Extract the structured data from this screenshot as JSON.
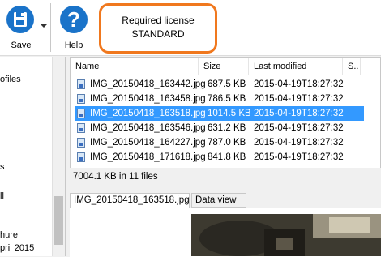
{
  "toolbar": {
    "save_label": "Save",
    "help_label": "Help",
    "save_icon": "floppy-disk-icon",
    "help_icon": "question-mark-icon"
  },
  "license": {
    "line1": "Required license",
    "line2": "STANDARD",
    "border_color": "#f0781e"
  },
  "tree": {
    "items": [
      "ofiles",
      "s",
      "ll",
      "hure",
      "pril 2015"
    ]
  },
  "file_list": {
    "columns": [
      "Name",
      "Size",
      "Last modified",
      "S.."
    ],
    "rows": [
      {
        "name": "IMG_20150418_163442.jpg",
        "size": "687.5 KB",
        "modified": "2015-04-19T18:27:32"
      },
      {
        "name": "IMG_20150418_163458.jpg",
        "size": "786.5 KB",
        "modified": "2015-04-19T18:27:32"
      },
      {
        "name": "IMG_20150418_163518.jpg",
        "size": "1014.5 KB",
        "modified": "2015-04-19T18:27:32",
        "selected": true
      },
      {
        "name": "IMG_20150418_163546.jpg",
        "size": "631.2 KB",
        "modified": "2015-04-19T18:27:32"
      },
      {
        "name": "IMG_20150418_164227.jpg",
        "size": "787.0 KB",
        "modified": "2015-04-19T18:27:32"
      },
      {
        "name": "IMG_20150418_171618.jpg",
        "size": "841.8 KB",
        "modified": "2015-04-19T18:27:32"
      }
    ],
    "summary": "7004.1 KB in 11 files",
    "selection_color": "#3399ff"
  },
  "preview": {
    "file_tab": "IMG_20150418_163518.jpg",
    "data_tab": "Data view"
  }
}
